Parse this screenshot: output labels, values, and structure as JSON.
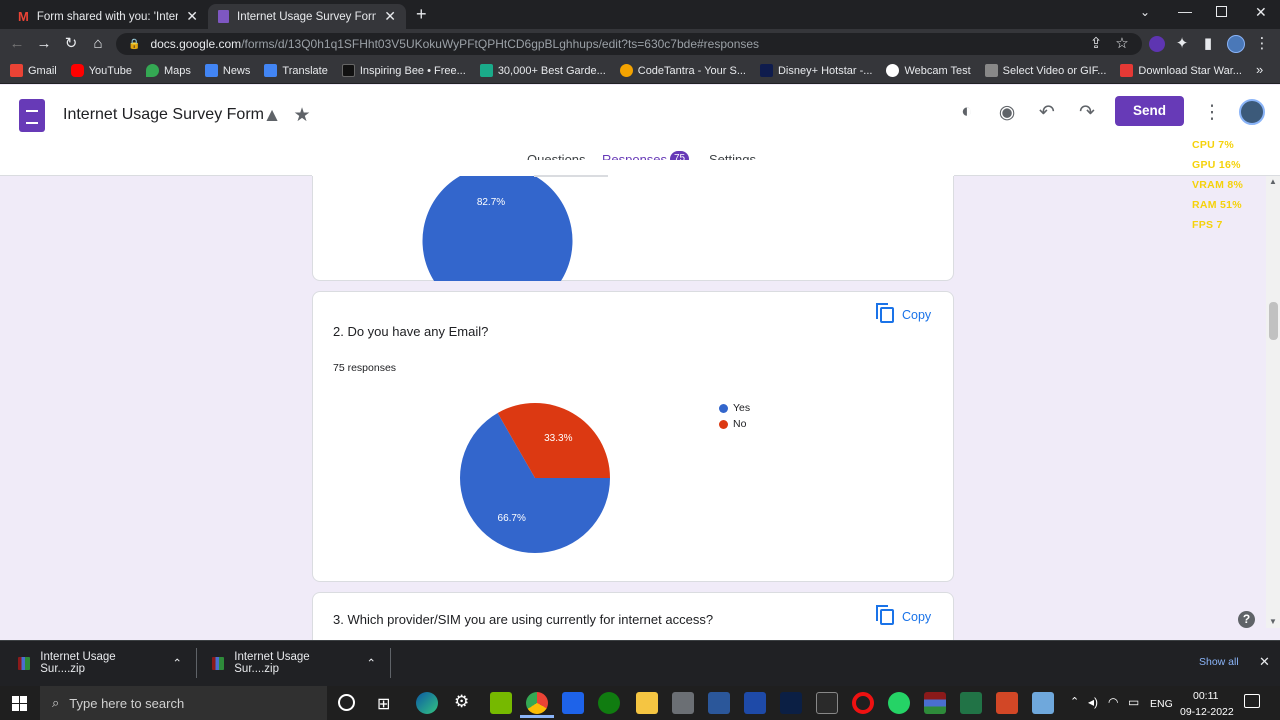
{
  "browser": {
    "tabs": [
      {
        "title": "Form shared with you: 'Internet U",
        "icon": "gmail-icon"
      },
      {
        "title": "Internet Usage Survey Form - Go",
        "icon": "forms-icon",
        "active": true
      }
    ],
    "url_host": "docs.google.com",
    "url_path": "/forms/d/13Q0h1q1SFHht03V5UKokuWyPFtQPHtCD6gpBLghhups/edit?ts=630c7bde#responses",
    "bookmarks": [
      {
        "label": "Gmail",
        "color": "#ea4335"
      },
      {
        "label": "YouTube",
        "color": "#ff0000"
      },
      {
        "label": "Maps",
        "color": "#34a853"
      },
      {
        "label": "News",
        "color": "#4285f4"
      },
      {
        "label": "Translate",
        "color": "#4285f4"
      },
      {
        "label": "Inspiring Bee • Free...",
        "color": "#111111"
      },
      {
        "label": "30,000+ Best Garde...",
        "color": "#1aab8a"
      },
      {
        "label": "CodeTantra - Your S...",
        "color": "#f4a300"
      },
      {
        "label": "Disney+ Hotstar -...",
        "color": "#0f1c4d"
      },
      {
        "label": "Webcam Test",
        "color": "#ffffff"
      },
      {
        "label": "Select Video or GIF...",
        "color": "#888888"
      },
      {
        "label": "Download Star War...",
        "color": "#e53935"
      }
    ],
    "bookmarks_overflow": "»"
  },
  "form": {
    "title": "Internet Usage Survey Form",
    "send_label": "Send",
    "tabs": {
      "questions": "Questions",
      "responses": "Responses",
      "responses_count": "75",
      "settings": "Settings"
    }
  },
  "overlay": {
    "cpu": "CPU  7%",
    "gpu": "GPU  16%",
    "vram": "VRAM  8%",
    "ram": "RAM  51%",
    "fps": "FPS   7"
  },
  "cards": {
    "q1": {
      "slice_label": "82.7%"
    },
    "q2": {
      "title": "2. Do you have any Email?",
      "responses": "75 responses",
      "copy_label": "Copy",
      "legend": [
        {
          "label": "Yes",
          "color": "#3366cc"
        },
        {
          "label": "No",
          "color": "#dc3912"
        }
      ]
    },
    "q3": {
      "title": "3. Which provider/SIM you are using currently for internet access?",
      "copy_label": "Copy"
    }
  },
  "chart_data": {
    "type": "pie",
    "title": "2. Do you have any Email?",
    "categories": [
      "Yes",
      "No"
    ],
    "values": [
      66.7,
      33.3
    ],
    "colors": [
      "#3366cc",
      "#dc3912"
    ],
    "data_labels": [
      "66.7%",
      "33.3%"
    ],
    "legend_position": "right"
  },
  "downloads": {
    "items": [
      "Internet Usage Sur....zip",
      "Internet Usage Sur....zip"
    ],
    "show_all": "Show all"
  },
  "taskbar": {
    "search_placeholder": "Type here to search",
    "lang": "ENG",
    "time": "00:11",
    "date": "09-12-2022"
  }
}
